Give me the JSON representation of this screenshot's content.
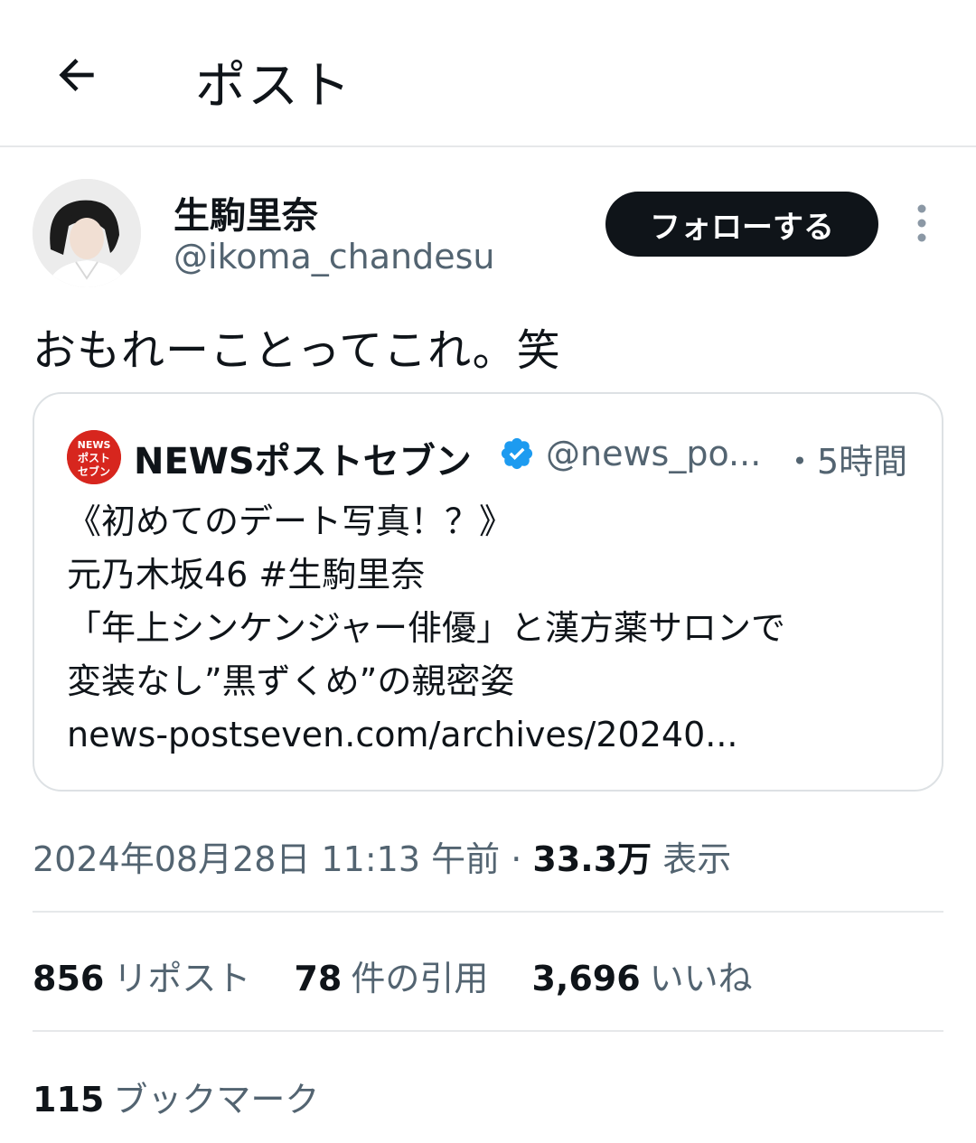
{
  "header": {
    "title": "ポスト"
  },
  "author": {
    "name": "生駒里奈",
    "handle": "@ikoma_chandesu",
    "follow_label": "フォローする"
  },
  "post": {
    "text": "おもれーことってこれ。笑"
  },
  "quote": {
    "logo_text": [
      "NEWS",
      "ポスト",
      "セブン"
    ],
    "name": "NEWSポストセブン",
    "handle": "@news_po...",
    "time": "・5時間",
    "lines": [
      "《初めてのデート写真！？》",
      "元乃木坂46 #生駒里奈",
      "「年上シンケンジャー俳優」と漢方薬サロンで",
      "変装なし”黒ずくめ”の親密姿",
      "news-postseven.com/archives/20240..."
    ]
  },
  "meta": {
    "datetime": "2024年08月28日 11:13 午前",
    "separator": "·",
    "views": "33.3万",
    "views_label": "表示"
  },
  "stats": {
    "reposts_count": "856",
    "reposts_label": "リポスト",
    "quotes_count": "78",
    "quotes_label": "件の引用",
    "likes_count": "3,696",
    "likes_label": "いいね"
  },
  "bookmarks": {
    "count": "115",
    "label": "ブックマーク"
  },
  "colors": {
    "text_primary": "#0f1419",
    "text_secondary": "#536471",
    "verified": "#1d9bf0",
    "brand_red": "#d7261e",
    "border": "#e6e8ea"
  },
  "icons": {
    "back": "arrow-left-icon",
    "more": "vertical-ellipsis-icon",
    "verified": "verified-badge-icon"
  }
}
